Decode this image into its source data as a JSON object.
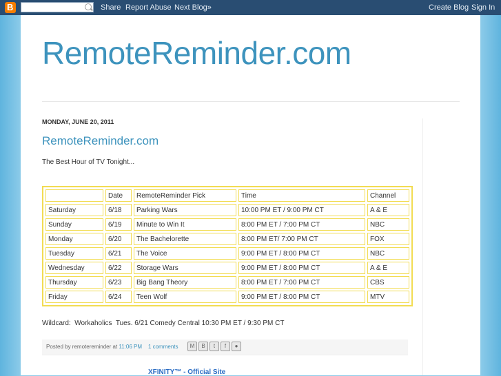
{
  "navbar": {
    "logo_glyph": "B",
    "search_value": "",
    "links": [
      "Share",
      "Report Abuse",
      "Next Blog»"
    ],
    "right_links": [
      "Create Blog",
      "Sign In"
    ]
  },
  "blog": {
    "title": "RemoteReminder.com"
  },
  "post": {
    "date_header": "MONDAY, JUNE 20, 2011",
    "title": "RemoteReminder.com",
    "intro": "The Best Hour of TV Tonight...",
    "table": {
      "headers": [
        "",
        "Date",
        "RemoteReminder Pick",
        "Time",
        "Channel"
      ],
      "rows": [
        [
          "Saturday",
          "6/18",
          "Parking Wars",
          "10:00 PM ET / 9:00 PM CT",
          "A & E"
        ],
        [
          "Sunday",
          "6/19",
          "Minute to Win It",
          "8:00 PM ET / 7:00 PM CT",
          "NBC"
        ],
        [
          "Monday",
          "6/20",
          "The Bachelorette",
          "8:00 PM ET/ 7:00 PM CT",
          "FOX"
        ],
        [
          "Tuesday",
          "6/21",
          "The Voice",
          "9:00 PM ET / 8:00 PM CT",
          "NBC"
        ],
        [
          "Wednesday",
          "6/22",
          "Storage Wars",
          "9:00 PM ET / 8:00 PM CT",
          "A & E"
        ],
        [
          "Thursday",
          "6/23",
          "Big Bang Theory",
          "8:00 PM ET / 7:00 PM CT",
          "CBS"
        ],
        [
          "Friday",
          "6/24",
          "Teen Wolf",
          "9:00 PM ET / 8:00 PM CT",
          "MTV"
        ]
      ]
    },
    "wildcard": "Wildcard:  Workaholics  Tues. 6/21 Comedy Central 10:30 PM ET / 9:30 PM CT",
    "footer": {
      "posted_by": "Posted by remotereminder at ",
      "time": "11:06 PM",
      "comments": "1 comments",
      "share_icons": [
        "email-icon",
        "blogthis-icon",
        "twitter-icon",
        "facebook-icon",
        "buzz-icon"
      ]
    }
  },
  "ad": {
    "link": "XFINITY™ - Official Site"
  }
}
